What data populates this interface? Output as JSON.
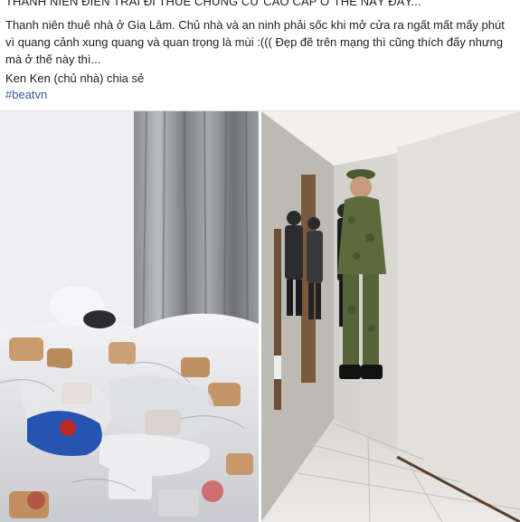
{
  "post": {
    "headline": "THANH NIÊN ĐIỂN TRAI ĐI THUÊ CHUNG CƯ CAO CẤP Ở THẾ NÀY ĐÂY...",
    "body": "Thanh niên thuê nhà ở Gia Lâm. Chủ nhà và an ninh phải sốc khi mở cửa ra ngất mất mấy phút vì quang cảnh xung quang và quan trọng là mùi :((( Đẹp đẽ trên mạng thì cũng thích đấy nhưng mà ở thế này thì...",
    "credit": "Ken Ken (chủ nhà) chia sẻ",
    "hashtag": "#beatvn"
  },
  "photos": {
    "left": {
      "subject": "messy-room-photo"
    },
    "right": {
      "subject": "hallway-people-photo"
    }
  },
  "colors": {
    "text": "#1c1e21",
    "link": "#385898",
    "divider": "#dddfe2"
  }
}
